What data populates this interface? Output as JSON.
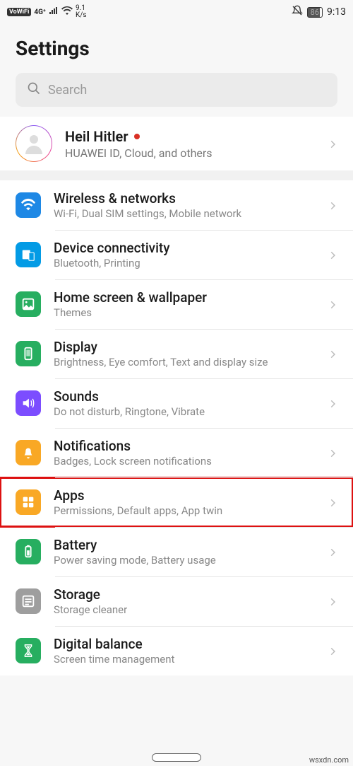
{
  "status": {
    "vowifi": "VoWiFi",
    "sig4g": "4G⁺",
    "speed_top": "9.1",
    "speed_bot": "K/s",
    "battery": "86",
    "time": "9:13"
  },
  "page": {
    "title": "Settings"
  },
  "search": {
    "placeholder": "Search"
  },
  "account": {
    "name": "Heil Hitler",
    "subtitle": "HUAWEI ID, Cloud, and others"
  },
  "items": [
    {
      "title": "Wireless & networks",
      "subtitle": "Wi-Fi, Dual SIM settings, Mobile network"
    },
    {
      "title": "Device connectivity",
      "subtitle": "Bluetooth, Printing"
    },
    {
      "title": "Home screen & wallpaper",
      "subtitle": "Themes"
    },
    {
      "title": "Display",
      "subtitle": "Brightness, Eye comfort, Text and display size"
    },
    {
      "title": "Sounds",
      "subtitle": "Do not disturb, Ringtone, Vibrate"
    },
    {
      "title": "Notifications",
      "subtitle": "Badges, Lock screen notifications"
    },
    {
      "title": "Apps",
      "subtitle": "Permissions, Default apps, App twin"
    },
    {
      "title": "Battery",
      "subtitle": "Power saving mode, Battery usage"
    },
    {
      "title": "Storage",
      "subtitle": "Storage cleaner"
    },
    {
      "title": "Digital balance",
      "subtitle": "Screen time management"
    }
  ],
  "watermark": "wsxdn.com"
}
